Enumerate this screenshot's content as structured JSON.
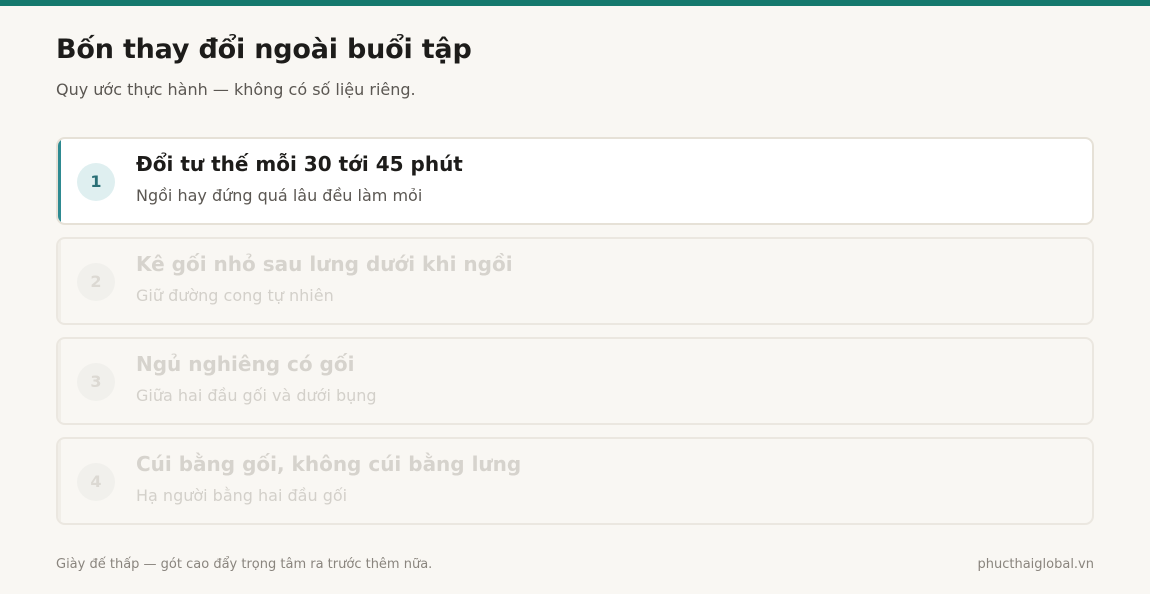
{
  "header": {
    "title": "Bốn thay đổi ngoài buổi tập",
    "subtitle": "Quy ước thực hành — không có số liệu riêng."
  },
  "items": [
    {
      "number": "1",
      "title": "Đổi tư thế mỗi 30 tới 45 phút",
      "description": "Ngồi hay đứng quá lâu đều làm mỏi",
      "active": true
    },
    {
      "number": "2",
      "title": "Kê gối nhỏ sau lưng dưới khi ngồi",
      "description": "Giữ đường cong tự nhiên",
      "active": false
    },
    {
      "number": "3",
      "title": "Ngủ nghiêng có gối",
      "description": "Giữa hai đầu gối và dưới bụng",
      "active": false
    },
    {
      "number": "4",
      "title": "Cúi bằng gối, không cúi bằng lưng",
      "description": "Hạ người bằng hai đầu gối",
      "active": false
    }
  ],
  "footer": {
    "note": "Giày đế thấp — gót cao đẩy trọng tâm ra trước thêm nữa.",
    "site": "phucthaiglobal.vn"
  },
  "colors": {
    "accent": "#15796d",
    "active_bar": "#2e8a91",
    "background": "#f9f7f3"
  }
}
